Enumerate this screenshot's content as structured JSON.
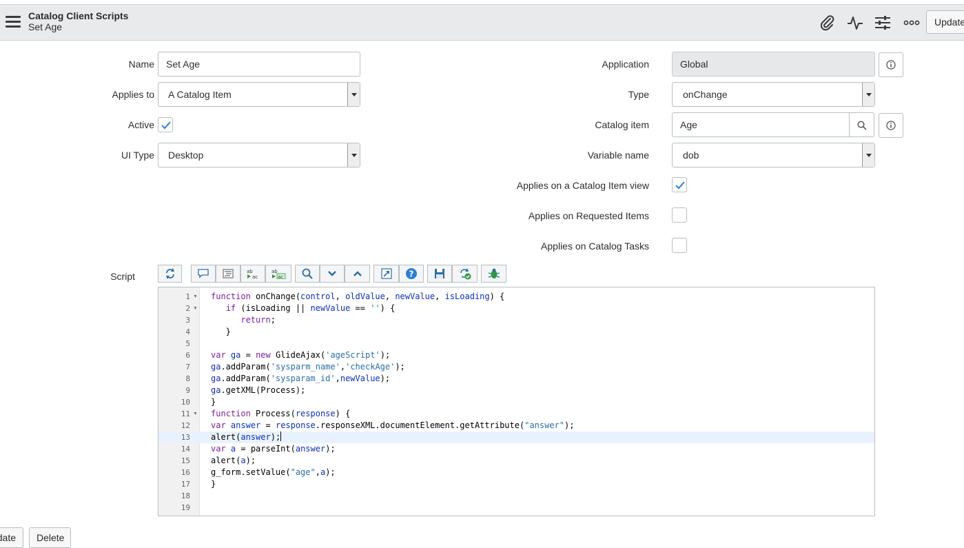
{
  "header": {
    "title": "Catalog Client Scripts",
    "subtitle": "Set Age",
    "update_label": "Update"
  },
  "form": {
    "name": {
      "label": "Name",
      "value": "Set Age"
    },
    "applies_to": {
      "label": "Applies to",
      "value": "A Catalog Item"
    },
    "active": {
      "label": "Active",
      "checked": true
    },
    "ui_type": {
      "label": "UI Type",
      "value": "Desktop"
    },
    "application": {
      "label": "Application",
      "value": "Global"
    },
    "type": {
      "label": "Type",
      "value": "onChange"
    },
    "catalog_item": {
      "label": "Catalog item",
      "value": "Age"
    },
    "variable_name": {
      "label": "Variable name",
      "value": "dob"
    },
    "applies_on_catalog_item_view": {
      "label": "Applies on a Catalog Item view",
      "checked": true
    },
    "applies_on_requested_items": {
      "label": "Applies on Requested Items",
      "checked": false
    },
    "applies_on_catalog_tasks": {
      "label": "Applies on Catalog Tasks",
      "checked": false
    },
    "script": {
      "label": "Script"
    }
  },
  "script_lines": [
    "function onChange(control, oldValue, newValue, isLoading) {",
    "   if (isLoading || newValue == '') {",
    "      return;",
    "   }",
    "",
    "var ga = new GlideAjax('ageScript');",
    "ga.addParam('sysparm_name','checkAge');",
    "ga.addParam('sysparam_id',newValue);",
    "ga.getXML(Process);",
    "}",
    "function Process(response) {",
    "var answer = response.responseXML.documentElement.getAttribute(\"answer\");",
    "alert(answer);",
    "var a = parseInt(answer);",
    "alert(a);",
    "g_form.setValue(\"age\",a);",
    "}",
    "",
    ""
  ],
  "script_line_numbers": [
    "1",
    "2",
    "3",
    "4",
    "5",
    "6",
    "7",
    "8",
    "9",
    "10",
    "11",
    "12",
    "13",
    "14",
    "15",
    "16",
    "17",
    "18",
    "19"
  ],
  "active_line": 13,
  "bottom_buttons": [
    "Update",
    "Delete"
  ],
  "icons": {
    "hamburger": "menu-icon",
    "attachment": "paperclip-icon",
    "activity": "pulse-icon",
    "settings": "sliders-icon",
    "more": "more-icon"
  },
  "colors": {
    "accent_check": "#2a7fd4",
    "keyword": "#7a1f9e",
    "variable": "#0b2fbf",
    "string": "#2a6ea8"
  }
}
